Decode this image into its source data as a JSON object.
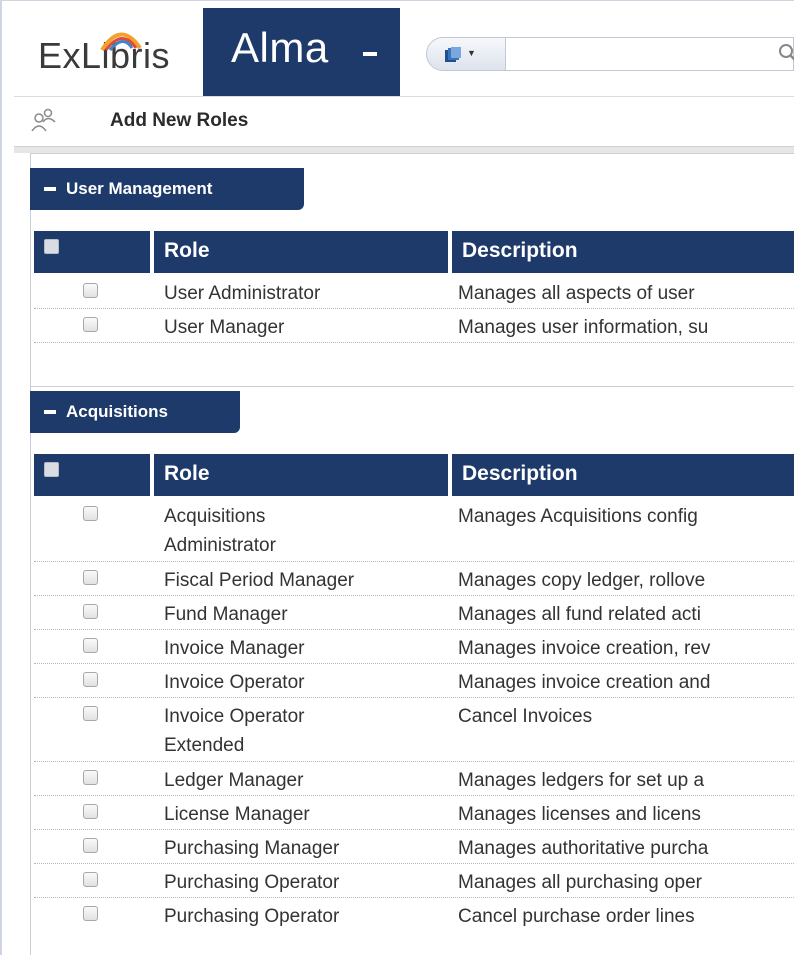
{
  "header": {
    "logo_text": "ExLibris",
    "app_name": "Alma",
    "search": {
      "value": "",
      "placeholder": ""
    }
  },
  "toolbar": {
    "add_new_roles_label": "Add New Roles"
  },
  "sections": {
    "user_management": {
      "title": "User Management",
      "columns": {
        "role": "Role",
        "description": "Description"
      },
      "rows": [
        {
          "role": "User Administrator",
          "description": "Manages all aspects of user"
        },
        {
          "role": "User Manager",
          "description": "Manages user information, su"
        }
      ]
    },
    "acquisitions": {
      "title": "Acquisitions",
      "columns": {
        "role": "Role",
        "description": "Description"
      },
      "rows": [
        {
          "role": "Acquisitions Administrator",
          "description": "Manages Acquisitions config"
        },
        {
          "role": "Fiscal Period Manager",
          "description": "Manages copy ledger, rollove"
        },
        {
          "role": "Fund Manager",
          "description": "Manages all fund related acti"
        },
        {
          "role": "Invoice Manager",
          "description": "Manages invoice creation, rev"
        },
        {
          "role": "Invoice Operator",
          "description": "Manages invoice creation and"
        },
        {
          "role": "Invoice Operator Extended",
          "description": "Cancel Invoices"
        },
        {
          "role": "Ledger Manager",
          "description": "Manages ledgers for set up a"
        },
        {
          "role": "License Manager",
          "description": "Manages licenses and licens"
        },
        {
          "role": "Purchasing Manager",
          "description": "Manages authoritative purcha"
        },
        {
          "role": "Purchasing Operator",
          "description": "Manages all purchasing oper"
        },
        {
          "role": "Purchasing Operator",
          "description": "Cancel purchase order lines"
        }
      ]
    }
  },
  "colors": {
    "brand_navy": "#1d3a6b",
    "header_bg": "#ffffff",
    "row_text": "#333333"
  },
  "icons": {
    "logo": "exlibris-logo",
    "search_type": "books-icon",
    "search": "magnifier-icon",
    "toolbar": "users-icon",
    "collapse": "minus-icon"
  }
}
